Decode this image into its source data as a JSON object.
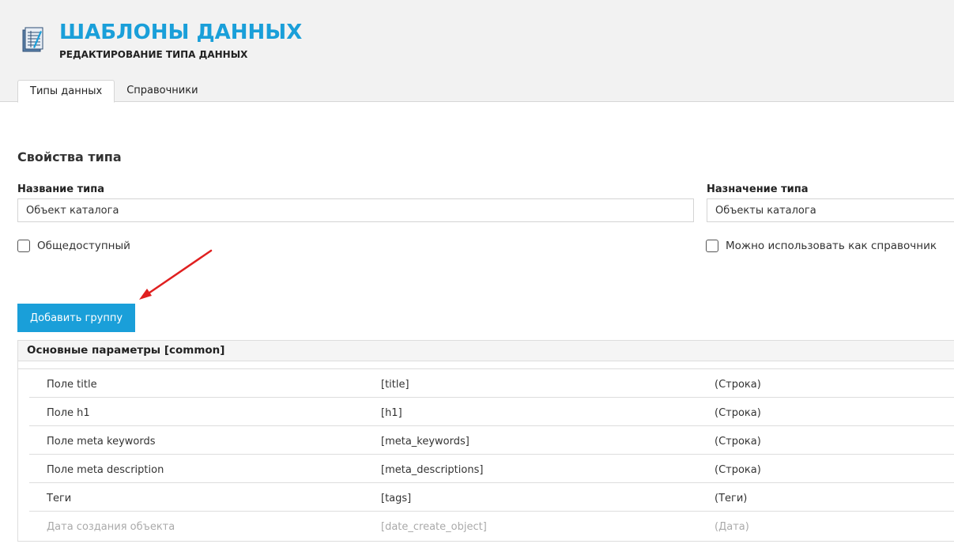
{
  "header": {
    "title": "ШАБЛОНЫ ДАННЫХ",
    "subtitle": "РЕДАКТИРОВАНИЕ ТИПА ДАННЫХ",
    "icon": "data-templates-icon"
  },
  "tabs": [
    {
      "label": "Типы данных",
      "active": true
    },
    {
      "label": "Справочники",
      "active": false
    }
  ],
  "form": {
    "section_title": "Свойства типа",
    "name_label": "Название типа",
    "name_value": "Объект каталога",
    "purpose_label": "Назначение типа",
    "purpose_value": "Объекты каталога",
    "public_checkbox": {
      "label": "Общедоступный",
      "checked": false
    },
    "reference_checkbox": {
      "label": "Можно использовать как справочник",
      "checked": false
    }
  },
  "add_group_label": "Добавить группу",
  "group": {
    "title": "Основные параметры [common]",
    "fields": [
      {
        "name": "Поле title",
        "id": "[title]",
        "type": "(Строка)",
        "disabled": false
      },
      {
        "name": "Поле h1",
        "id": "[h1]",
        "type": "(Строка)",
        "disabled": false
      },
      {
        "name": "Поле meta keywords",
        "id": "[meta_keywords]",
        "type": "(Строка)",
        "disabled": false
      },
      {
        "name": "Поле meta description",
        "id": "[meta_descriptions]",
        "type": "(Строка)",
        "disabled": false
      },
      {
        "name": "Теги",
        "id": "[tags]",
        "type": "(Теги)",
        "disabled": false
      },
      {
        "name": "Дата создания объекта",
        "id": "[date_create_object]",
        "type": "(Дата)",
        "disabled": true
      }
    ]
  },
  "colors": {
    "accent": "#1a9fd9",
    "arrow": "#e02020",
    "disabled_text": "#aaaaaa"
  }
}
